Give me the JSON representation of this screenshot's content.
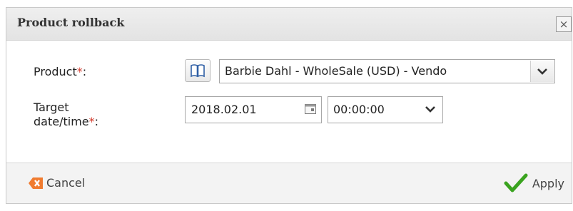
{
  "dialog": {
    "title": "Product rollback",
    "close_glyph": "×",
    "close_icon": "close-icon"
  },
  "form": {
    "product": {
      "label": "Product",
      "required_mark": "*",
      "label_suffix": ":",
      "browse_icon": "book-icon",
      "value": "Barbie Dahl - WholeSale (USD) - Vendo",
      "dropdown_icon": "chevron-down-icon"
    },
    "target": {
      "label_line1": "Target",
      "label_line2": "date/time",
      "required_mark": "*",
      "label_suffix": ":",
      "date_value": "2018.02.01",
      "calendar_icon": "calendar-icon",
      "time_value": "00:00:00",
      "dropdown_icon": "chevron-down-icon"
    }
  },
  "footer": {
    "cancel_label": "Cancel",
    "cancel_icon": "cancel-x-icon",
    "apply_label": "Apply",
    "apply_icon": "checkmark-icon"
  },
  "colors": {
    "required": "#d43a2c",
    "cancel_icon": "#f07b2f",
    "apply_check": "#3aa31f",
    "titlebar": "#e8e8e8"
  }
}
